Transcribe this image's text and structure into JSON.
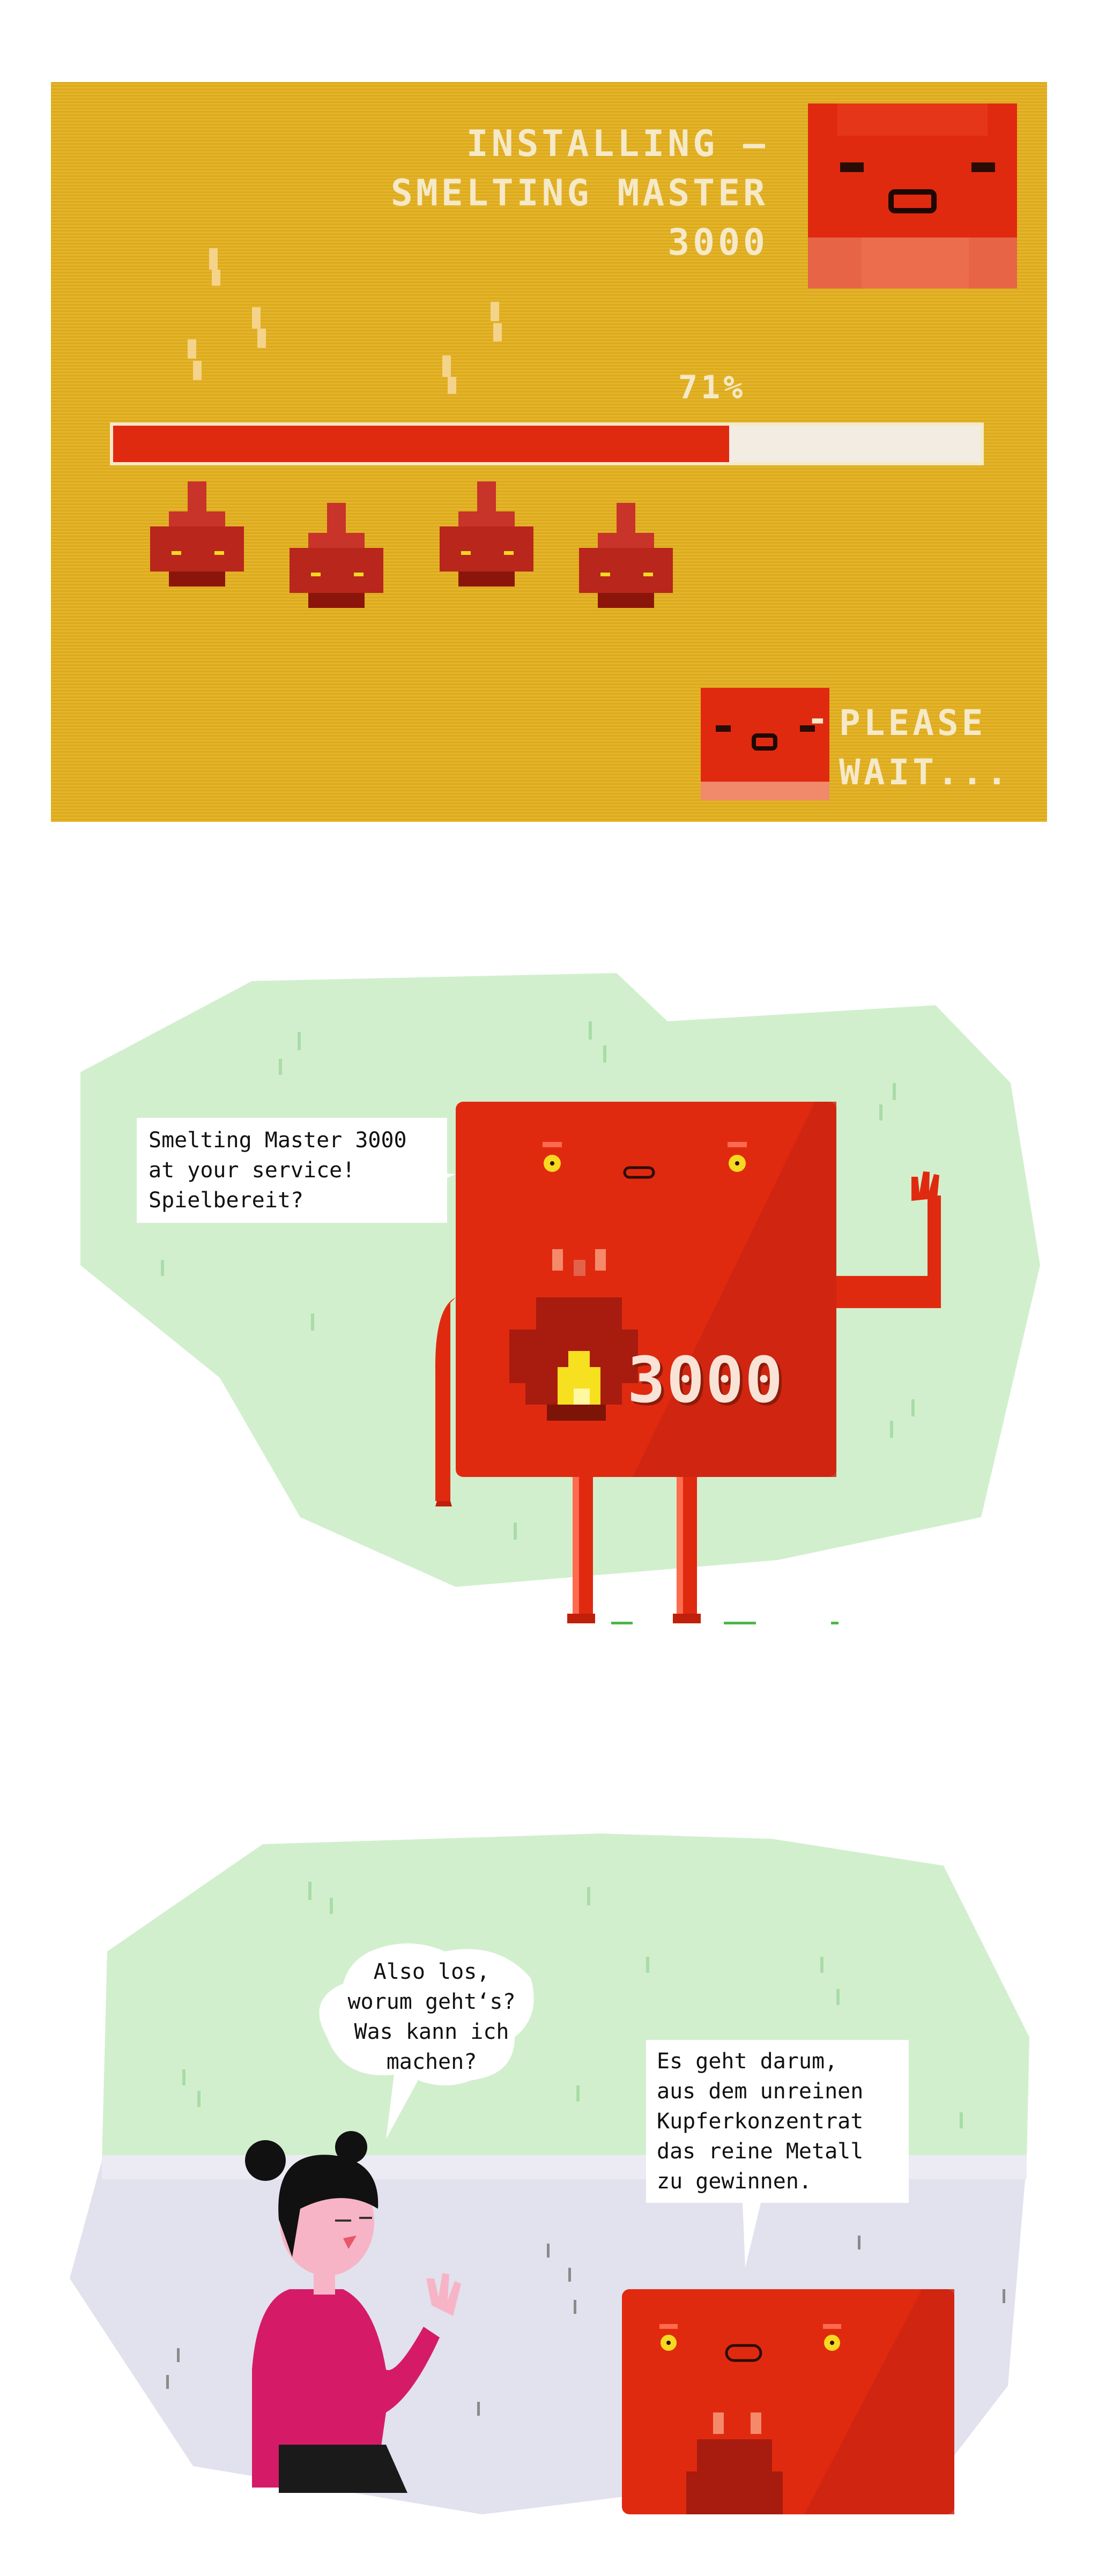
{
  "panel1": {
    "title": "INSTALLING —\nSMELTING MASTER\n3000",
    "progress_label": "71%",
    "progress": 0.71,
    "dash": "-",
    "wait_text": "PLEASE\nWAIT..."
  },
  "panel2": {
    "speech": "Smelting Master 3000\nat your service!\nSpielbereit?",
    "counter": "3000"
  },
  "panel3": {
    "girl_speech": "Also los,\nworum geht‘s?\nWas kann ich\nmachen?",
    "robot_speech": "Es geht darum,\naus dem unreinen\nKupferkonzentrat\ndas reine Metall\nzu gewinnen."
  },
  "colors": {
    "screen": "#e3b01f",
    "robot_red": "#e02a10",
    "dark_red": "#a71c0e",
    "mint": "#d1efcd",
    "lilac": "#e2e1ee",
    "skin": "#f7b4c6",
    "sweater": "#d51b68"
  }
}
